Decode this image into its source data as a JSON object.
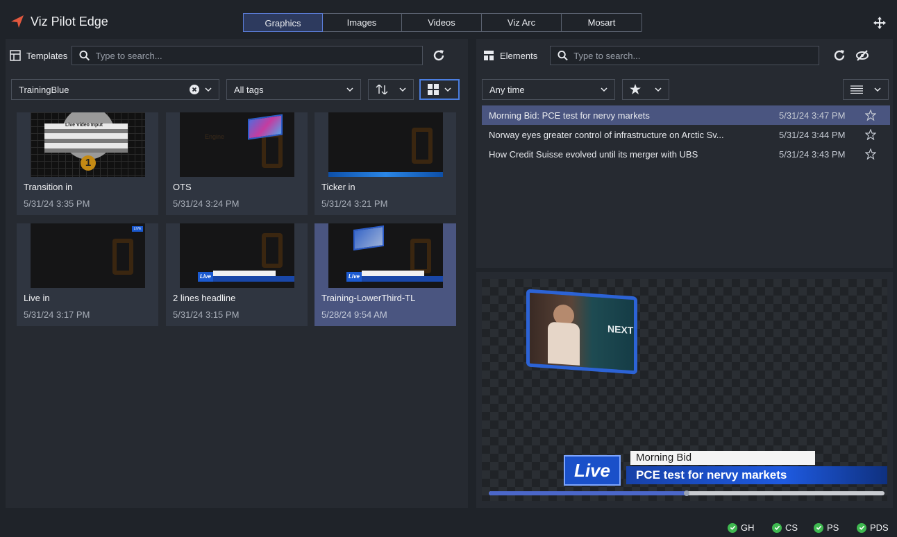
{
  "app": {
    "title": "Viz Pilot Edge",
    "accent": "#e2583e"
  },
  "tabs": [
    {
      "label": "Graphics",
      "active": true
    },
    {
      "label": "Images"
    },
    {
      "label": "Videos"
    },
    {
      "label": "Viz Arc"
    },
    {
      "label": "Mosart"
    }
  ],
  "templates": {
    "label": "Templates",
    "search_placeholder": "Type to search...",
    "folder_value": "TrainingBlue",
    "tags_value": "All tags",
    "cards": [
      {
        "name": "Transition in",
        "date": "5/31/24 3:35 PM"
      },
      {
        "name": "OTS",
        "date": "5/31/24 3:24 PM"
      },
      {
        "name": "Ticker in",
        "date": "5/31/24 3:21 PM"
      },
      {
        "name": "Live in",
        "date": "5/31/24 3:17 PM"
      },
      {
        "name": "2 lines headline",
        "date": "5/31/24 3:15 PM"
      },
      {
        "name": "Training-LowerThird-TL",
        "date": "5/28/24 9:54 AM",
        "selected": true
      }
    ],
    "thumb_text": {
      "live_video_input": "Live Video Input",
      "number": "1",
      "live": "Live",
      "live_badge": "LIVE"
    }
  },
  "elements": {
    "label": "Elements",
    "search_placeholder": "Type to search...",
    "time_value": "Any time",
    "rows": [
      {
        "title": "Morning Bid: PCE test for nervy markets",
        "date": "5/31/24 3:47 PM",
        "selected": true
      },
      {
        "title": "Norway eyes greater control of infrastructure on Arctic Sv...",
        "date": "5/31/24 3:44 PM"
      },
      {
        "title": "How Credit Suisse evolved until its merger with UBS",
        "date": "5/31/24 3:43 PM"
      }
    ]
  },
  "preview": {
    "live_label": "Live",
    "headline_top": "Morning Bid",
    "headline_main": "PCE test for nervy markets",
    "next_label": "NEXT",
    "progress_fraction": 0.5
  },
  "status": [
    {
      "label": "GH",
      "color": "#3fb950"
    },
    {
      "label": "CS",
      "color": "#3fb950"
    },
    {
      "label": "PS",
      "color": "#3fb950"
    },
    {
      "label": "PDS",
      "color": "#3fb950"
    }
  ]
}
